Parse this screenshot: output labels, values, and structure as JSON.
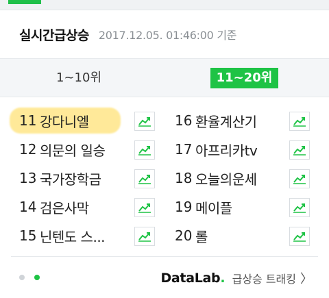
{
  "header": {
    "title": "실시간급상승",
    "timestamp": "2017.12.05. 01:46:00 기준"
  },
  "tabs": [
    {
      "label": "1~10위"
    },
    {
      "label": "11~20위"
    }
  ],
  "keywords_left": [
    {
      "rank": "11",
      "keyword": "강다니엘"
    },
    {
      "rank": "12",
      "keyword": "의문의 일승"
    },
    {
      "rank": "13",
      "keyword": "국가장학금"
    },
    {
      "rank": "14",
      "keyword": "검은사막"
    },
    {
      "rank": "15",
      "keyword": "닌텐도 스..."
    }
  ],
  "keywords_right": [
    {
      "rank": "16",
      "keyword": "환율계산기"
    },
    {
      "rank": "17",
      "keyword": "아프리카tv"
    },
    {
      "rank": "18",
      "keyword": "오늘의운세"
    },
    {
      "rank": "19",
      "keyword": "메이플"
    },
    {
      "rank": "20",
      "keyword": "롤"
    }
  ],
  "footer": {
    "brand": "DataLab",
    "brand_dot": ".",
    "link_label": "급상승 트래킹",
    "chevron": "〉"
  },
  "colors": {
    "accent": "#1ec345",
    "highlight": "#ffe277"
  },
  "icons": {
    "trend": "trend-chart-icon"
  }
}
